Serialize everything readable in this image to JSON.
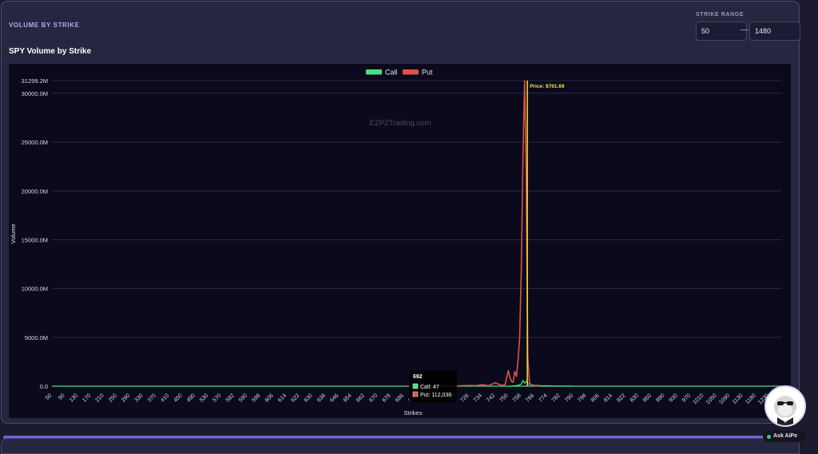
{
  "section_title": "VOLUME BY STRIKE",
  "strike_range": {
    "label": "STRIKE RANGE",
    "min": "50",
    "max": "1480"
  },
  "ask_button": "Ask AiPe",
  "chart_data": {
    "type": "line",
    "title": "SPY Volume by Strike",
    "xlabel": "Strikes",
    "ylabel": "Volume",
    "watermark": "EZPZTrading.com",
    "legend": {
      "position": "top"
    },
    "y_ticks": [
      "0.0",
      "5000.0M",
      "10000.0M",
      "15000.0M",
      "20000.0M",
      "25000.0M",
      "30000.0M",
      "31299.2M"
    ],
    "ylim": [
      0,
      31299.2
    ],
    "x_ticks": [
      "50",
      "90",
      "130",
      "170",
      "210",
      "250",
      "290",
      "330",
      "370",
      "410",
      "450",
      "490",
      "530",
      "570",
      "582",
      "590",
      "598",
      "606",
      "614",
      "622",
      "630",
      "638",
      "646",
      "654",
      "662",
      "670",
      "678",
      "686",
      "694",
      "702",
      "710",
      "718",
      "726",
      "734",
      "742",
      "750",
      "758",
      "766",
      "774",
      "782",
      "790",
      "798",
      "806",
      "814",
      "822",
      "830",
      "850",
      "890",
      "930",
      "970",
      "1010",
      "1050",
      "1090",
      "1130",
      "1180",
      "1230",
      "1330"
    ],
    "price_line": {
      "label": "Price: $761.69",
      "strike": 761.69
    },
    "series": [
      {
        "name": "Call",
        "color": "#4ade80",
        "points": [
          [
            750,
            0
          ],
          [
            752,
            20
          ],
          [
            754,
            40
          ],
          [
            756,
            80
          ],
          [
            758,
            200
          ],
          [
            759,
            600
          ],
          [
            760,
            300
          ],
          [
            761,
            500
          ],
          [
            762,
            250
          ],
          [
            764,
            150
          ],
          [
            766,
            100
          ],
          [
            770,
            60
          ],
          [
            774,
            40
          ],
          [
            780,
            20
          ],
          [
            790,
            0
          ]
        ]
      },
      {
        "name": "Put",
        "color": "#e0504a",
        "points": [
          [
            690,
            0
          ],
          [
            700,
            10
          ],
          [
            720,
            40
          ],
          [
            726,
            80
          ],
          [
            730,
            60
          ],
          [
            734,
            150
          ],
          [
            738,
            50
          ],
          [
            742,
            350
          ],
          [
            746,
            80
          ],
          [
            748,
            150
          ],
          [
            750,
            1600
          ],
          [
            751,
            900
          ],
          [
            752,
            500
          ],
          [
            753,
            400
          ],
          [
            754,
            1500
          ],
          [
            755,
            1000
          ],
          [
            756,
            2600
          ],
          [
            757,
            5000
          ],
          [
            758,
            12000
          ],
          [
            759,
            23000
          ],
          [
            760,
            31299.2
          ],
          [
            761,
            22000
          ],
          [
            762,
            3000
          ],
          [
            763,
            400
          ],
          [
            764,
            100
          ],
          [
            766,
            40
          ],
          [
            770,
            0
          ]
        ]
      }
    ],
    "tooltip": {
      "strike": "692",
      "call": "Call: 47",
      "put": "Put: 112,038"
    }
  }
}
